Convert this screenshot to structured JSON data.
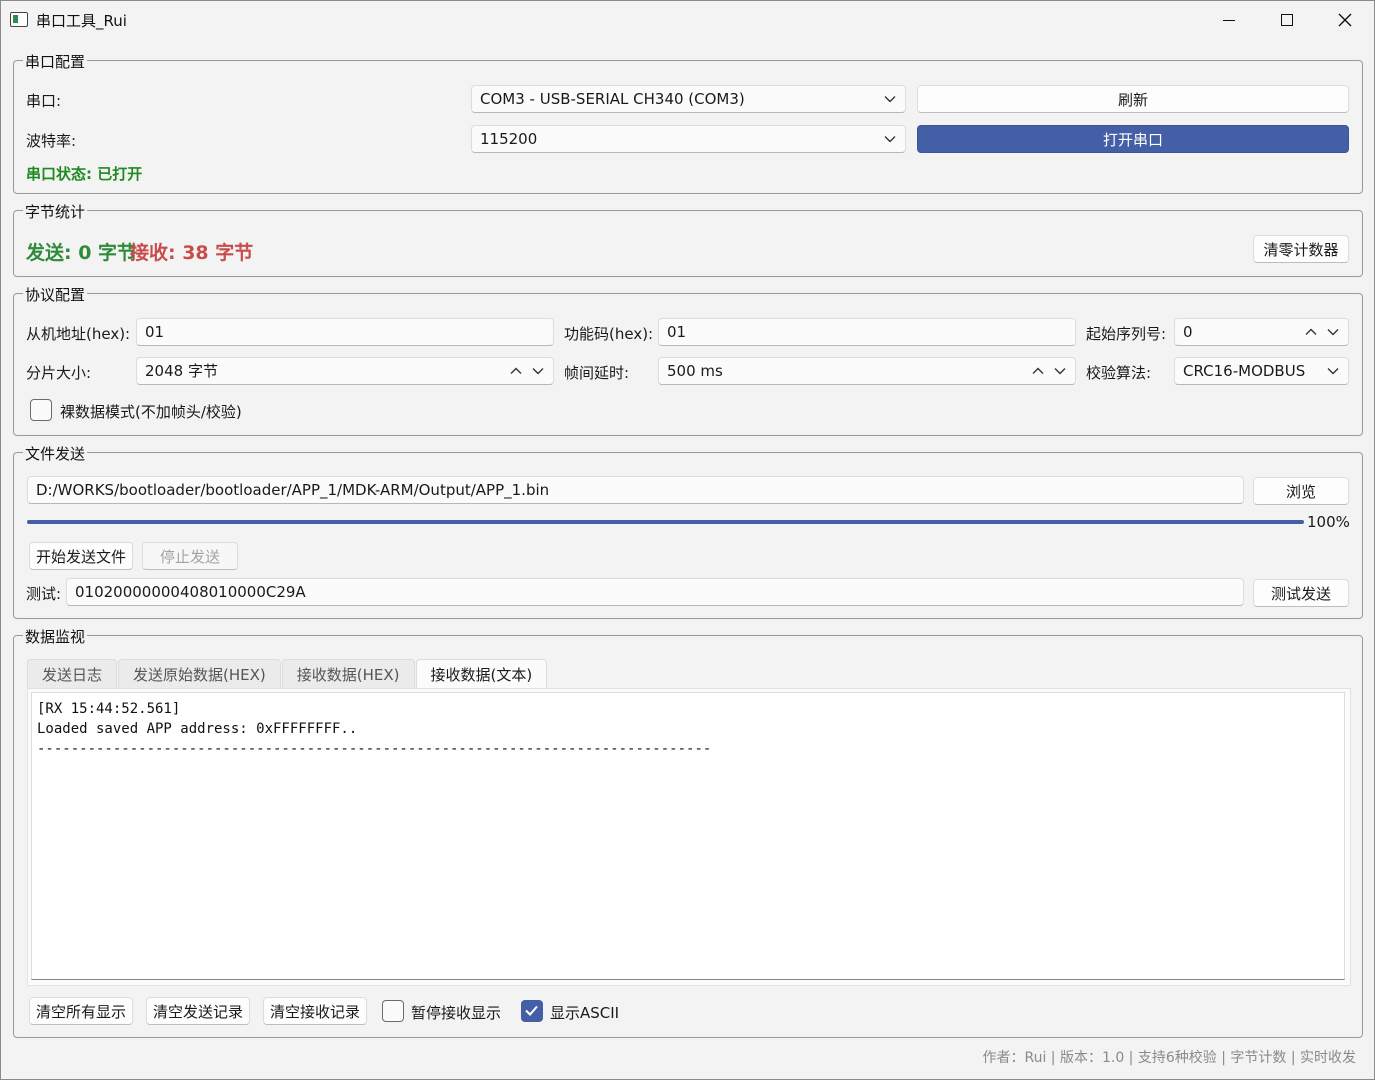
{
  "window": {
    "title": "串口工具_Rui",
    "controls": {
      "minimize": "minimize-icon",
      "maximize": "maximize-icon",
      "close": "close-icon"
    }
  },
  "serial_config": {
    "legend": "串口配置",
    "port_label": "串口:",
    "port_value": "COM3 - USB-SERIAL CH340 (COM3)",
    "refresh_button": "刷新",
    "baud_label": "波特率:",
    "baud_value": "115200",
    "open_button": "打开串口",
    "status_text": "串口状态: 已打开"
  },
  "byte_stats": {
    "legend": "字节统计",
    "sent_text": "发送: 0 字节",
    "recv_text": "接收: 38 字节",
    "reset_button": "清零计数器",
    "sent_color": "#2e8b3a",
    "recv_color": "#c94c4c"
  },
  "protocol": {
    "legend": "协议配置",
    "slave_label": "从机地址(hex):",
    "slave_value": "01",
    "func_label": "功能码(hex):",
    "func_value": "01",
    "seq_label": "起始序列号:",
    "seq_value": "0",
    "chunk_label": "分片大小:",
    "chunk_value": "2048 字节",
    "delay_label": "帧间延时:",
    "delay_value": "500 ms",
    "check_label": "校验算法:",
    "check_value": "CRC16-MODBUS",
    "raw_mode_label": "裸数据模式(不加帧头/校验)",
    "raw_mode_checked": false
  },
  "file_send": {
    "legend": "文件发送",
    "path_value": "D:/WORKS/bootloader/bootloader/APP_1/MDK-ARM/Output/APP_1.bin",
    "browse_button": "浏览",
    "progress": 1.0,
    "progress_text": "100%",
    "start_button": "开始发送文件",
    "stop_button": "停止发送",
    "test_label": "测试:",
    "test_value": "01020000000408010000C29A",
    "test_button": "测试发送"
  },
  "monitor": {
    "legend": "数据监视",
    "tabs": [
      {
        "label": "发送日志",
        "active": false
      },
      {
        "label": "发送原始数据(HEX)",
        "active": false
      },
      {
        "label": "接收数据(HEX)",
        "active": false
      },
      {
        "label": "接收数据(文本)",
        "active": true
      }
    ],
    "content": "[RX 15:44:52.561]\nLoaded saved APP address: 0xFFFFFFFF..\n--------------------------------------------------------------------------------",
    "clear_all_button": "清空所有显示",
    "clear_send_button": "清空发送记录",
    "clear_recv_button": "清空接收记录",
    "pause_label": "暂停接收显示",
    "pause_checked": false,
    "ascii_label": "显示ASCII",
    "ascii_checked": true
  },
  "footer": "作者：Rui | 版本：1.0 | 支持6种校验 | 字节计数 | 实时收发"
}
